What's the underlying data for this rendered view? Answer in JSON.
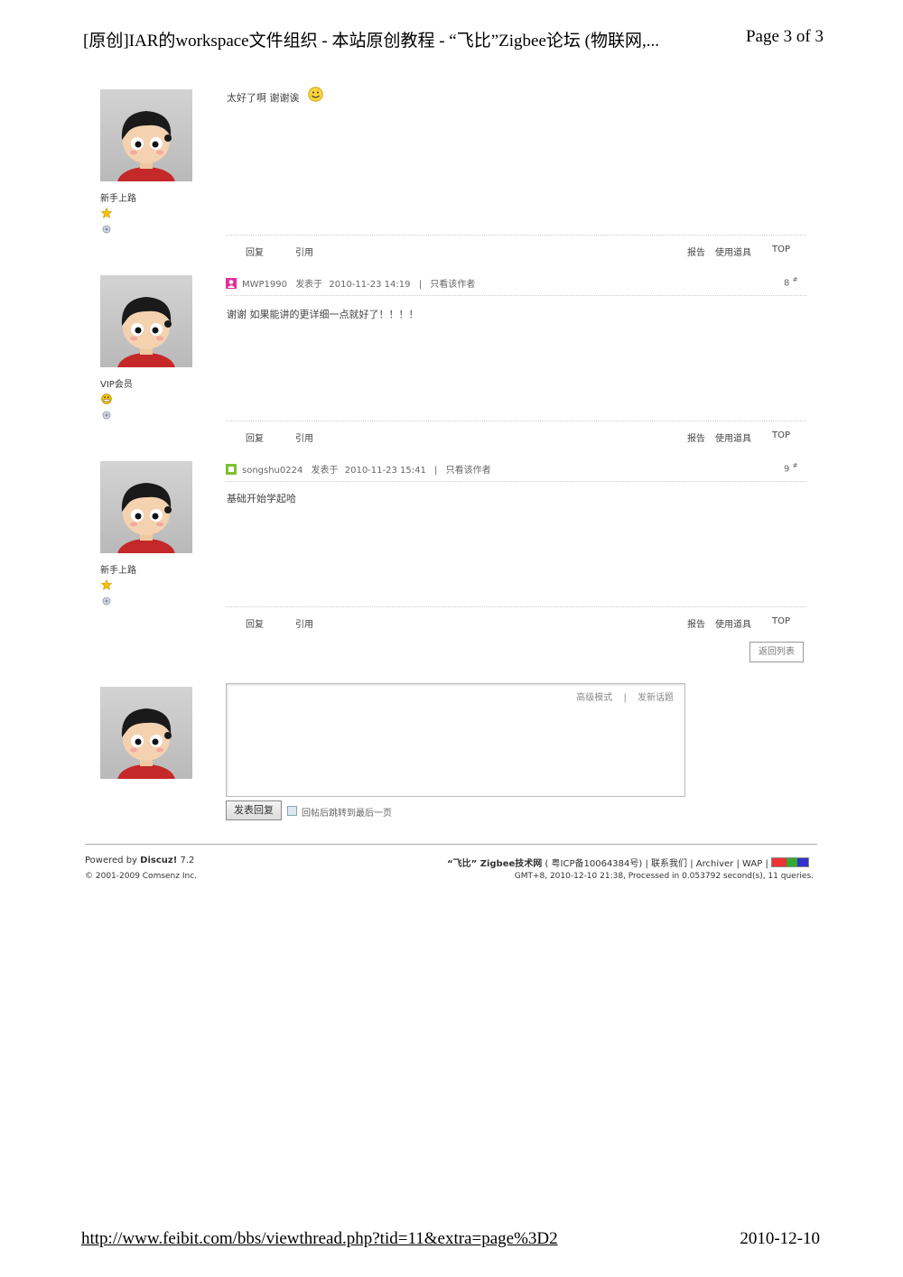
{
  "print_header": {
    "title": "[原创]IAR的workspace文件组织 - 本站原创教程 - “飞比”Zigbee论坛 (物联网,...",
    "page": "Page 3 of 3"
  },
  "posts": [
    {
      "rank": "新手上路",
      "message": "太好了啊 谢谢诶",
      "emoticon": "smile-emoticon",
      "actions": {
        "reply": "回复",
        "quote": "引用",
        "report": "报告",
        "tools": "使用道具",
        "top": "TOP"
      }
    },
    {
      "username": "MWP1990",
      "posted_label": "发表于",
      "datetime": "2010-11-23 14:19",
      "sep": "|",
      "only_author": "只看该作者",
      "floor": "8",
      "floor_mark": "#",
      "rank": "VIP会员",
      "message": "谢谢  如果能讲的更详细一点就好了！！！！",
      "user_color": "#e0309a",
      "actions": {
        "reply": "回复",
        "quote": "引用",
        "report": "报告",
        "tools": "使用道具",
        "top": "TOP"
      }
    },
    {
      "username": "songshu0224",
      "posted_label": "发表于",
      "datetime": "2010-11-23 15:41",
      "sep": "|",
      "only_author": "只看该作者",
      "floor": "9",
      "floor_mark": "#",
      "rank": "新手上路",
      "message": "基础开始学起哈",
      "user_color": "#7cc230",
      "actions": {
        "reply": "回复",
        "quote": "引用",
        "report": "报告",
        "tools": "使用道具",
        "top": "TOP"
      }
    }
  ],
  "back_to_list": "返回列表",
  "reply_box": {
    "advanced_mode": "高级模式",
    "sep": "|",
    "new_topic": "发新话题",
    "submit": "发表回复",
    "jump_label": "回帖后跳转到最后一页"
  },
  "footer": {
    "powered_prefix": "Powered by",
    "discuz": "Discuz!",
    "version": "7.2",
    "copyright": "© 2001-2009 Comsenz Inc.",
    "site_name": "“飞比” Zigbee技术网",
    "icp": "( 粤ICP备10064384号)",
    "contact": "| 联系我们",
    "archiver": "| Archiver",
    "wap": "| WAP |",
    "stats": "GMT+8, 2010-12-10 21:38, Processed in 0.053792 second(s), 11 queries."
  },
  "print_footer": {
    "url": "http://www.feibit.com/bbs/viewthread.php?tid=11&extra=page%3D2",
    "date": "2010-12-10"
  }
}
